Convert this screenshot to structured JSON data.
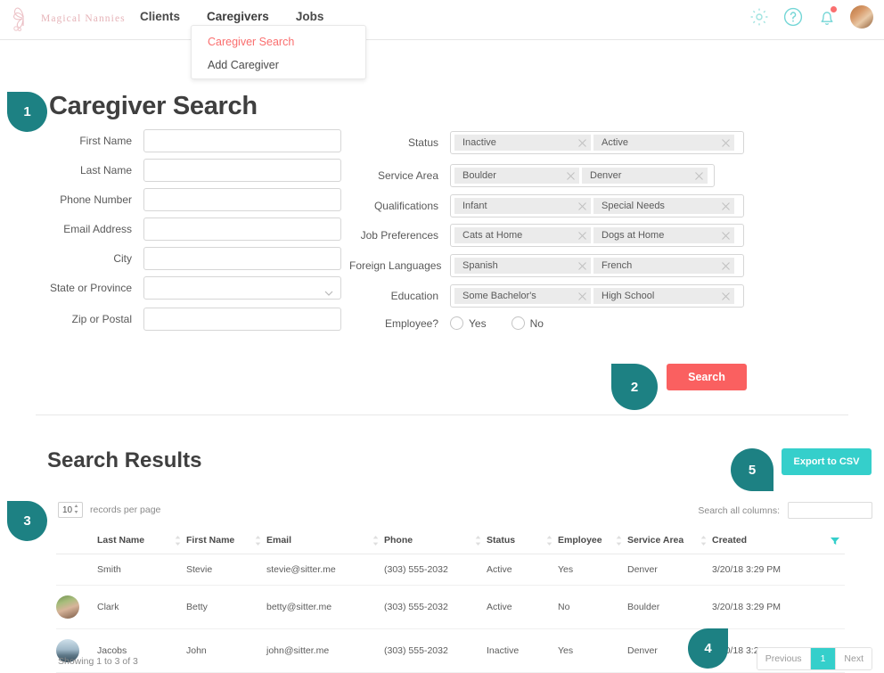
{
  "header": {
    "logo_text": "Magical Nannies",
    "logo_icon": "butterfly-icon",
    "nav": [
      {
        "label": "Clients"
      },
      {
        "label": "Caregivers"
      },
      {
        "label": "Jobs"
      }
    ],
    "dropdown": {
      "items": [
        {
          "label": "Caregiver Search",
          "state": "active"
        },
        {
          "label": "Add Caregiver",
          "state": "normal"
        }
      ]
    },
    "icons": [
      {
        "name": "gear-icon"
      },
      {
        "name": "help-circle-icon"
      },
      {
        "name": "bell-icon"
      },
      {
        "name": "user-avatar"
      }
    ]
  },
  "badges": {
    "one": "1",
    "two": "2",
    "three": "3",
    "four": "4",
    "five": "5"
  },
  "search": {
    "title": "Caregiver Search",
    "left_fields": [
      {
        "label": "First Name",
        "value": "",
        "type": "text"
      },
      {
        "label": "Last Name",
        "value": "",
        "type": "text"
      },
      {
        "label": "Phone Number",
        "value": "",
        "type": "text"
      },
      {
        "label": "Email Address",
        "value": "",
        "type": "text"
      },
      {
        "label": "City",
        "value": "",
        "type": "text"
      },
      {
        "label": "State or Province",
        "value": "",
        "type": "select"
      },
      {
        "label": "Zip or Postal",
        "value": "",
        "type": "text"
      }
    ],
    "right_fields": [
      {
        "label": "Status",
        "chips": [
          "Inactive",
          "Active"
        ]
      },
      {
        "label": "Service Area",
        "chips": [
          "Boulder",
          "Denver"
        ]
      },
      {
        "label": "Qualifications",
        "chips": [
          "Infant",
          "Special Needs"
        ]
      },
      {
        "label": "Job Preferences",
        "chips": [
          "Cats at Home",
          "Dogs at Home"
        ]
      },
      {
        "label": "Foreign Languages",
        "chips": [
          "Spanish",
          "French"
        ]
      },
      {
        "label": "Education",
        "chips": [
          "Some Bachelor's",
          "High School"
        ]
      }
    ],
    "employee": {
      "label": "Employee?",
      "options": [
        "Yes",
        "No"
      ],
      "selected": ""
    },
    "search_button": "Search"
  },
  "results": {
    "title": "Search Results",
    "export_button": "Export to CSV",
    "records_per_page": {
      "value": "10",
      "label": "records per page"
    },
    "search_all_columns": {
      "label": "Search all columns:",
      "value": "",
      "placeholder": ""
    },
    "columns": [
      "Last Name",
      "First Name",
      "Email",
      "Phone",
      "Status",
      "Employee",
      "Service Area",
      "Created"
    ],
    "rows": [
      {
        "avatar": "none",
        "last_name": "Smith",
        "first_name": "Stevie",
        "email": "stevie@sitter.me",
        "phone": "(303) 555-2032",
        "status": "Active",
        "employee": "Yes",
        "service_area": "Denver",
        "created": "3/20/18 3:29 PM"
      },
      {
        "avatar": "betty",
        "last_name": "Clark",
        "first_name": "Betty",
        "email": "betty@sitter.me",
        "phone": "(303) 555-2032",
        "status": "Active",
        "employee": "No",
        "service_area": "Boulder",
        "created": "3/20/18 3:29 PM"
      },
      {
        "avatar": "john",
        "last_name": "Jacobs",
        "first_name": "John",
        "email": "john@sitter.me",
        "phone": "(303) 555-2032",
        "status": "Inactive",
        "employee": "Yes",
        "service_area": "Denver",
        "created": "3/20/18 3:29 PM"
      }
    ],
    "showing": "Showing 1 to 3 of 3",
    "pager": {
      "previous": "Previous",
      "pages": [
        "1"
      ],
      "next": "Next",
      "current": "1"
    }
  },
  "colors": {
    "badge_teal": "#1d8183",
    "accent_red": "#fa6060",
    "link_red": "#fa6f6f",
    "turquoise": "#35cfcb",
    "logo_pink": "#e6b3b8"
  }
}
